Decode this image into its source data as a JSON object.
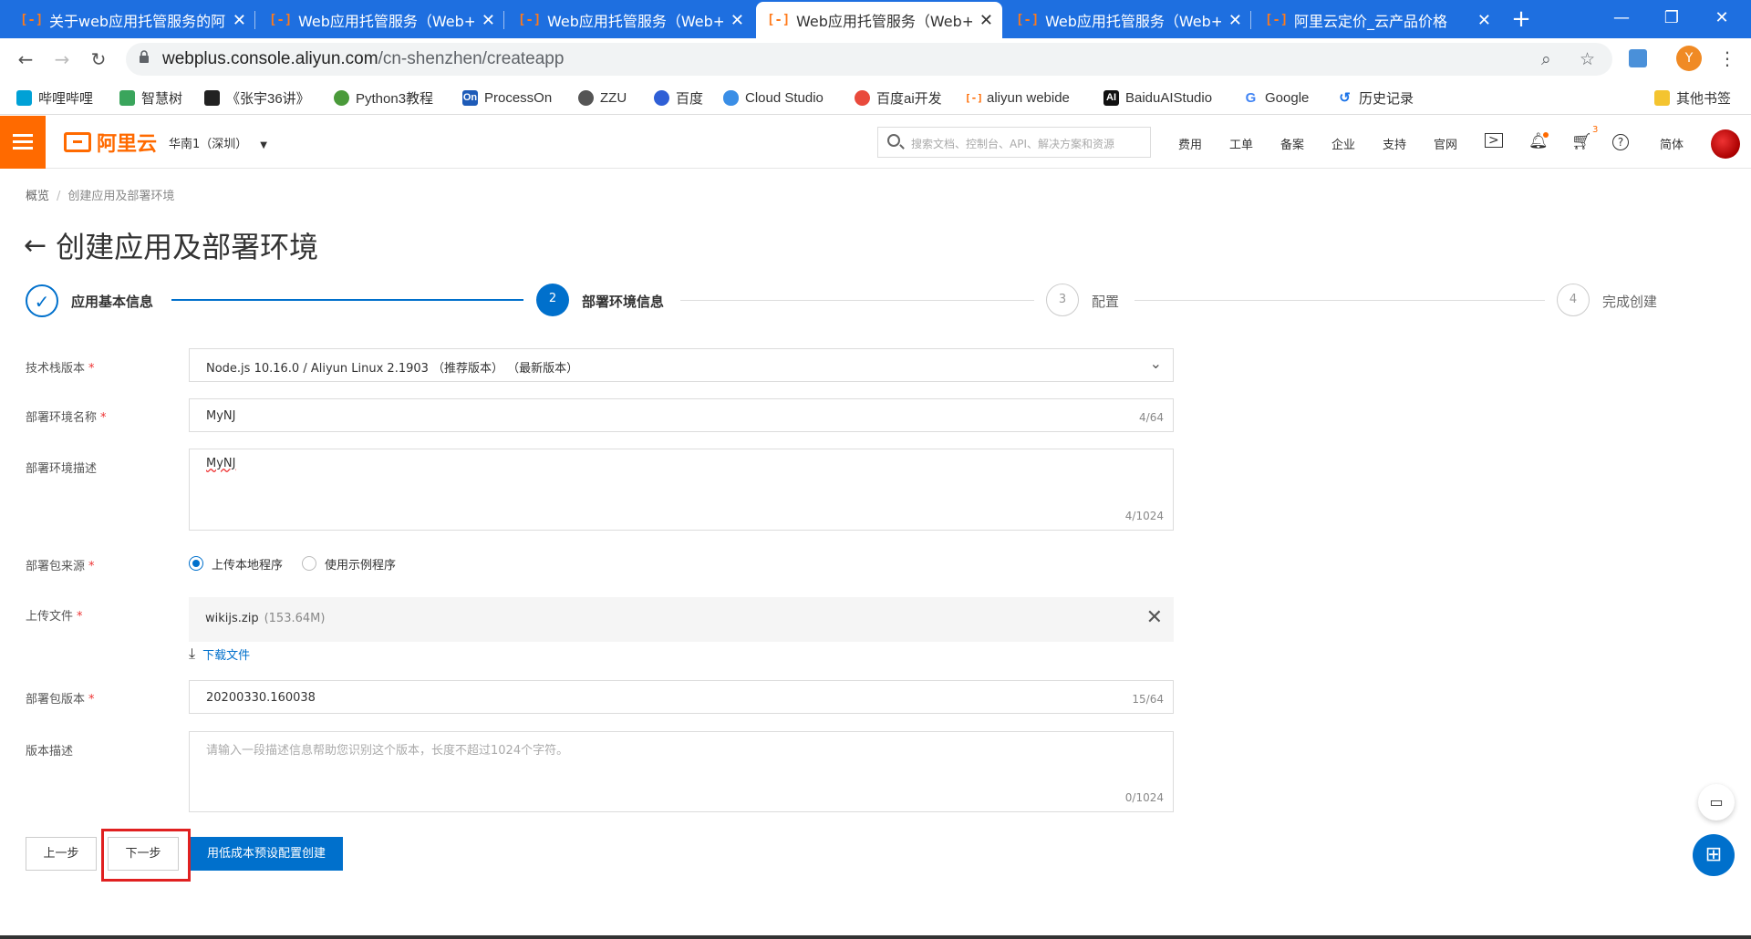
{
  "browser": {
    "tabs": [
      {
        "label": "关于web应用托管服务的阿里",
        "active": false
      },
      {
        "label": "Web应用托管服务（Web+）",
        "active": false
      },
      {
        "label": "Web应用托管服务（Web+）",
        "active": false
      },
      {
        "label": "Web应用托管服务（Web+）",
        "active": true
      },
      {
        "label": "Web应用托管服务（Web+）",
        "active": false
      },
      {
        "label": "阿里云定价_云产品价格",
        "active": false
      }
    ],
    "tab_close": "✕",
    "new_tab": "+",
    "url_host": "webplus.console.aliyun.com",
    "url_path": "/cn-shenzhen/createapp",
    "profile_initial": "Y",
    "bookmarks": [
      {
        "label": "哔哩哔哩",
        "icon": "bilibili-icon",
        "color": "#00a1d6"
      },
      {
        "label": "智慧树",
        "icon": "zhihuishu-icon",
        "color": "#3aa55c"
      },
      {
        "label": "《张宇36讲》",
        "icon": "video-icon",
        "color": "#222222"
      },
      {
        "label": "Python3教程",
        "icon": "python-icon",
        "color": "#4a9a3a"
      },
      {
        "label": "ProcessOn",
        "icon": "processon-icon",
        "color": "#1e5bb8"
      },
      {
        "label": "ZZU",
        "icon": "globe-icon",
        "color": "#555555"
      },
      {
        "label": "百度",
        "icon": "baidu-icon",
        "color": "#2f5fd6"
      },
      {
        "label": "Cloud Studio",
        "icon": "cloud-icon",
        "color": "#3a8ee6"
      },
      {
        "label": "百度ai开发",
        "icon": "baidu-ai-icon",
        "color": "#e94a3c"
      },
      {
        "label": "aliyun webide",
        "icon": "aliyun-icon",
        "color": "#ff6a00"
      },
      {
        "label": "BaiduAIStudio",
        "icon": "ai-studio-icon",
        "color": "#111111"
      },
      {
        "label": "Google",
        "icon": "google-icon",
        "color": "#4285f4"
      },
      {
        "label": "历史记录",
        "icon": "history-icon",
        "color": "#1a73e8"
      }
    ],
    "other_bookmarks": "其他书签"
  },
  "console": {
    "logo_text": "阿里云",
    "region": "华南1（深圳）",
    "search_placeholder": "搜索文档、控制台、API、解决方案和资源",
    "nav_links": [
      "费用",
      "工单",
      "备案",
      "企业",
      "支持",
      "官网"
    ],
    "cart_count": "3",
    "lang": "简体"
  },
  "page": {
    "breadcrumb": [
      "概览",
      "创建应用及部署环境"
    ],
    "breadcrumb_sep": "/",
    "title": "创建应用及部署环境",
    "steps": [
      {
        "num": "✓",
        "label": "应用基本信息",
        "state": "done"
      },
      {
        "num": "2",
        "label": "部署环境信息",
        "state": "active"
      },
      {
        "num": "3",
        "label": "配置",
        "state": "todo"
      },
      {
        "num": "4",
        "label": "完成创建",
        "state": "todo"
      }
    ],
    "form": {
      "stack_label": "技术栈版本",
      "stack_value": "Node.js 10.16.0 / Aliyun Linux 2.1903 （推荐版本） （最新版本）",
      "env_name_label": "部署环境名称",
      "env_name_value": "MyNJ",
      "env_name_count": "4/64",
      "env_desc_label": "部署环境描述",
      "env_desc_value": "MyNJ",
      "env_desc_count": "4/1024",
      "source_label": "部署包来源",
      "source_options": [
        "上传本地程序",
        "使用示例程序"
      ],
      "source_selected": 0,
      "upload_label": "上传文件",
      "upload_file": "wikijs.zip",
      "upload_size": "(153.64M)",
      "download_link": "下载文件",
      "pkg_version_label": "部署包版本",
      "pkg_version_value": "20200330.160038",
      "pkg_version_count": "15/64",
      "version_desc_label": "版本描述",
      "version_desc_placeholder": "请输入一段描述信息帮助您识别这个版本，长度不超过1024个字符。",
      "version_desc_count": "0/1024",
      "required_mark": "*"
    },
    "buttons": {
      "prev": "上一步",
      "next": "下一步",
      "low_cost": "用低成本预设配置创建"
    }
  },
  "colors": {
    "tabbar": "#1e6fe0",
    "brand_orange": "#ff6a00",
    "primary_blue": "#0070cc",
    "highlight_red": "#e02020"
  }
}
